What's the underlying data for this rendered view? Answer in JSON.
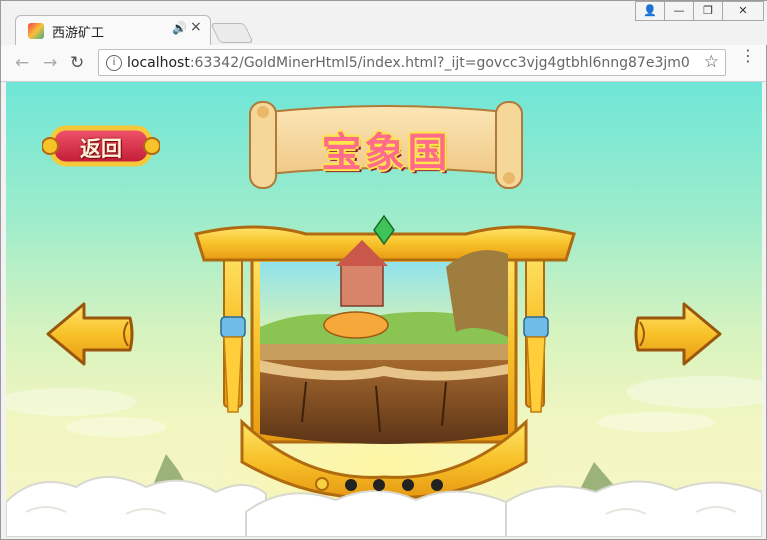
{
  "browser": {
    "tab_title": "西游矿工",
    "tab_audio": "🔊",
    "tab_close": "×",
    "window_buttons": [
      "👤",
      "—",
      "❐",
      "✕"
    ],
    "url_host": "localhost",
    "url_path": ":63342/GoldMinerHtml5/index.html?_ijt=govcc3vjg4gtbhl6nng87e3jm0",
    "back": "←",
    "forward": "→",
    "reload": "↻",
    "star": "☆",
    "menu": "⋮"
  },
  "game": {
    "back_button_label": "返回",
    "level_title": "宝象国",
    "pager": {
      "count": 5,
      "active_index": 0
    },
    "colors": {
      "gold": "#f8c22a",
      "red": "#d9233f",
      "teal_sky": "#6ee6d7"
    }
  }
}
